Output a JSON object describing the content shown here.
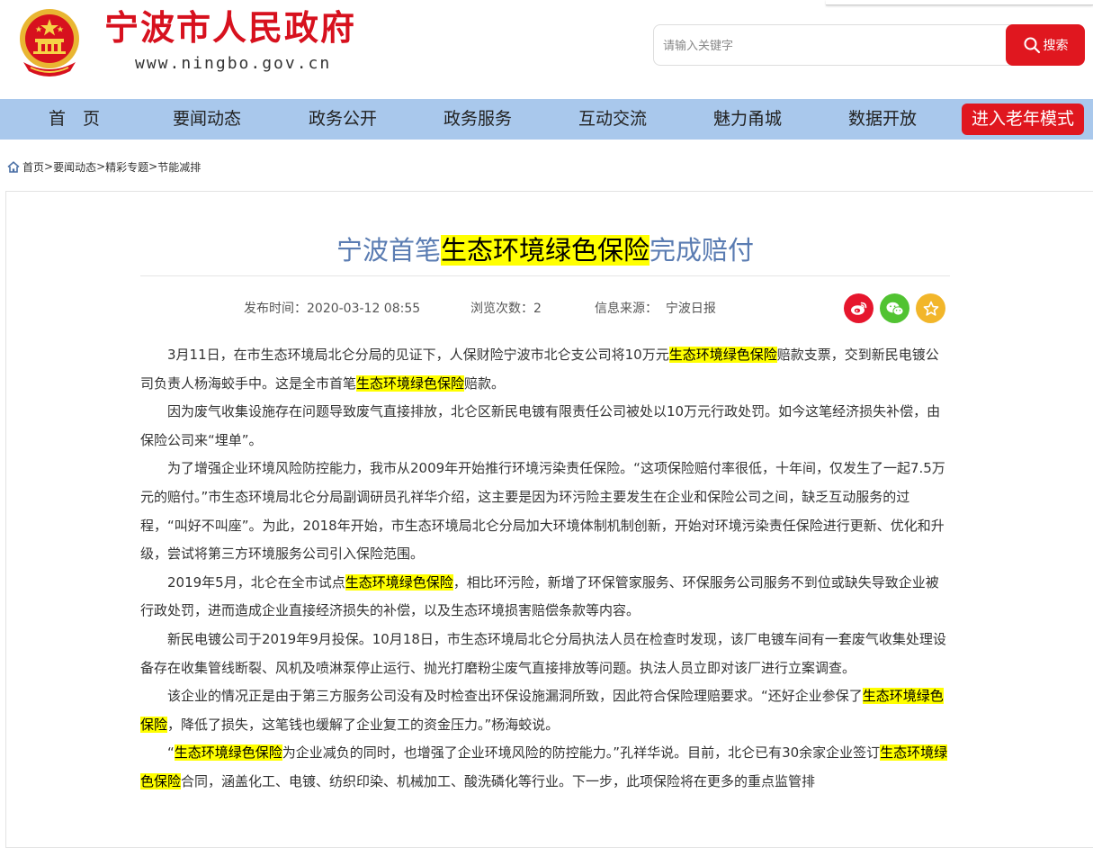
{
  "header": {
    "site_title": "宁波市人民政府",
    "site_url": "www.ningbo.gov.cn",
    "search_placeholder": "请输入关键字",
    "search_button": "搜索"
  },
  "nav": {
    "items": [
      "首　页",
      "要闻动态",
      "政务公开",
      "政务服务",
      "互动交流",
      "魅力甬城",
      "数据开放"
    ],
    "elder_mode": "进入老年模式"
  },
  "breadcrumb": {
    "items": [
      "首页",
      "要闻动态",
      "精彩专题",
      "节能减排"
    ],
    "separator": ">"
  },
  "article": {
    "title_pre": "宁波首笔",
    "title_hl": "生态环境绿色保险",
    "title_post": "完成赔付",
    "meta": {
      "publish_time": "发布时间：2020-03-12 08:55",
      "views": "浏览次数：2",
      "source": "信息来源：  宁波日报"
    },
    "paragraphs": [
      [
        {
          "t": "3月11日，在市生态环境局北仑分局的见证下，人保财险宁波市北仑支公司将10万元"
        },
        {
          "t": "生态环境绿色保险",
          "hl": true
        },
        {
          "t": "赔款支票，交到新民电镀公司负责人杨海蛟手中。这是全市首笔"
        },
        {
          "t": "生态环境绿色保险",
          "hl": true
        },
        {
          "t": "赔款。"
        }
      ],
      [
        {
          "t": "因为废气收集设施存在问题导致废气直接排放，北仑区新民电镀有限责任公司被处以10万元行政处罚。如今这笔经济损失补偿，由保险公司来“埋单”。"
        }
      ],
      [
        {
          "t": "为了增强企业环境风险防控能力，我市从2009年开始推行环境污染责任保险。“这项保险赔付率很低，十年间，仅发生了一起7.5万元的赔付。”市生态环境局北仑分局副调研员孔祥华介绍，这主要是因为环污险主要发生在企业和保险公司之间，缺乏互动服务的过程，“叫好不叫座”。为此，2018年开始，市生态环境局北仑分局加大环境体制机制创新，开始对环境污染责任保险进行更新、优化和升级，尝试将第三方环境服务公司引入保险范围。"
        }
      ],
      [
        {
          "t": "2019年5月，北仑在全市试点"
        },
        {
          "t": "生态环境绿色保险",
          "hl": true
        },
        {
          "t": "，相比环污险，新增了环保管家服务、环保服务公司服务不到位或缺失导致企业被行政处罚，进而造成企业直接经济损失的补偿，以及生态环境损害赔偿条款等内容。"
        }
      ],
      [
        {
          "t": "新民电镀公司于2019年9月投保。10月18日，市生态环境局北仑分局执法人员在检查时发现，该厂电镀车间有一套废气收集处理设备存在收集管线断裂、风机及喷淋泵停止运行、抛光打磨粉尘废气直接排放等问题。执法人员立即对该厂进行立案调查。"
        }
      ],
      [
        {
          "t": "该企业的情况正是由于第三方服务公司没有及时检查出环保设施漏洞所致，因此符合保险理赔要求。“还好企业参保了"
        },
        {
          "t": "生态环境绿色保险",
          "hl": true
        },
        {
          "t": "，降低了损失，这笔钱也缓解了企业复工的资金压力。”杨海蛟说。"
        }
      ],
      [
        {
          "t": "“"
        },
        {
          "t": "生态环境绿色保险",
          "hl": true
        },
        {
          "t": "为企业减负的同时，也增强了企业环境风险的防控能力。”孔祥华说。目前，北仑已有30余家企业签订"
        },
        {
          "t": "生态环境绿色保险",
          "hl": true
        },
        {
          "t": "合同，涵盖化工、电镀、纺织印染、机械加工、酸洗磷化等行业。下一步，此项保险将在更多的重点监管排"
        }
      ]
    ]
  },
  "colors": {
    "brand_red": "#d7111e",
    "nav_bg": "#a9c8ec",
    "title_blue": "#5a7cb2",
    "highlight": "#ffff00",
    "weibo": "#e6162d",
    "wechat": "#51c332",
    "favorite": "#f2b62a"
  },
  "icons": [
    "national-emblem-icon",
    "search-icon",
    "home-icon",
    "weibo-icon",
    "wechat-icon",
    "star-icon"
  ]
}
